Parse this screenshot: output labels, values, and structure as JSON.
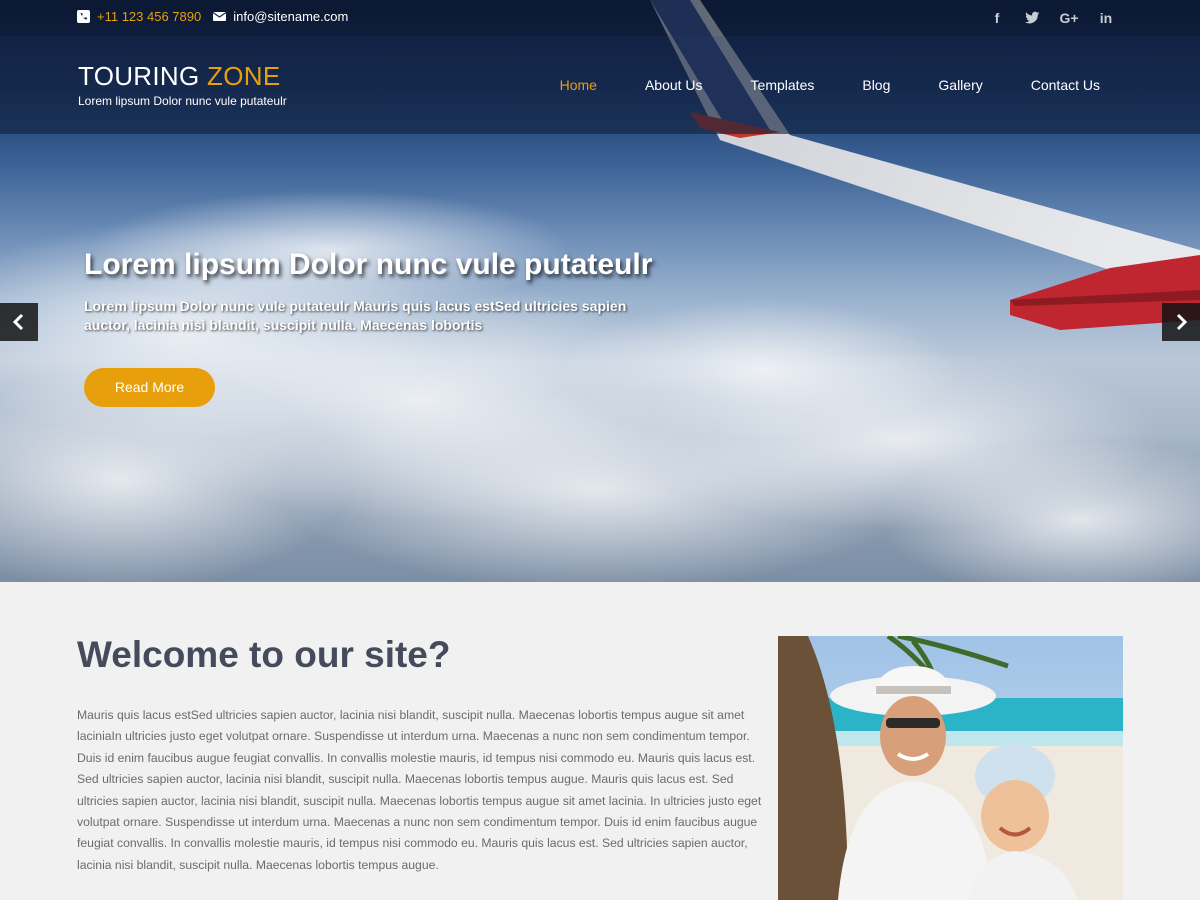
{
  "topbar": {
    "phone": "+11 123 456 7890",
    "email": "info@sitename.com",
    "social": [
      "f",
      "twitter-icon",
      "G+",
      "in"
    ]
  },
  "header": {
    "logo_part1": "TOURING ",
    "logo_part2": "ZONE",
    "tagline": "Lorem lipsum Dolor nunc vule putateulr"
  },
  "nav": {
    "items": [
      "Home",
      "About Us",
      "Templates",
      "Blog",
      "Gallery",
      "Contact Us"
    ],
    "active": "Home"
  },
  "slider": {
    "title": "Lorem lipsum Dolor nunc vule putateulr",
    "description": "Lorem lipsum Dolor nunc vule putateulr Mauris quis lacus estSed ultricies sapien auctor, lacinia nisi blandit, suscipit nulla. Maecenas lobortis",
    "button_label": "Read More"
  },
  "welcome": {
    "title": "Welcome to our site?",
    "text": "Mauris quis lacus estSed ultricies sapien auctor, lacinia nisi blandit, suscipit nulla. Maecenas lobortis tempus augue sit amet laciniaIn ultricies justo eget volutpat ornare. Suspendisse ut interdum urna. Maecenas a nunc non sem condimentum tempor. Duis id enim faucibus augue feugiat convallis. In convallis molestie mauris, id tempus nisi commodo eu. Mauris quis lacus est. Sed ultricies sapien auctor, lacinia nisi blandit, suscipit nulla. Maecenas lobortis tempus augue. Mauris quis lacus est. Sed ultricies sapien auctor, lacinia nisi blandit, suscipit nulla. Maecenas lobortis tempus augue sit amet lacinia. In ultricies justo eget volutpat ornare. Suspendisse ut interdum urna. Maecenas a nunc non sem condimentum tempor. Duis id enim faucibus augue feugiat convallis. In convallis molestie mauris, id tempus nisi commodo eu. Mauris quis lacus est. Sed ultricies sapien auctor, lacinia nisi blandit, suscipit nulla. Maecenas lobortis tempus augue."
  },
  "colors": {
    "accent": "#e89f0c",
    "heading": "#454b5c",
    "body_text": "#6b6b6b",
    "section_bg": "#f1f1f1"
  },
  "icons": {
    "prev": "chevron-left-icon",
    "next": "chevron-right-icon",
    "phone": "phone-icon",
    "email": "envelope-icon"
  }
}
